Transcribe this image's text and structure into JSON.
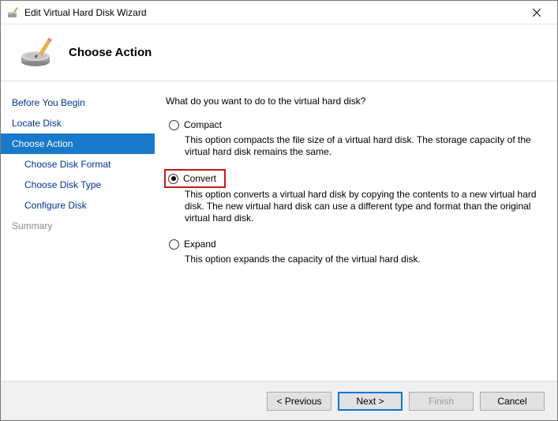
{
  "window": {
    "title": "Edit Virtual Hard Disk Wizard"
  },
  "header": {
    "title": "Choose Action"
  },
  "sidebar": {
    "items": [
      {
        "label": "Before You Begin",
        "state": "normal"
      },
      {
        "label": "Locate Disk",
        "state": "normal"
      },
      {
        "label": "Choose Action",
        "state": "selected"
      },
      {
        "label": "Choose Disk Format",
        "state": "sub"
      },
      {
        "label": "Choose Disk Type",
        "state": "sub"
      },
      {
        "label": "Configure Disk",
        "state": "sub"
      },
      {
        "label": "Summary",
        "state": "disabled"
      }
    ]
  },
  "content": {
    "question": "What do you want to do to the virtual hard disk?",
    "options": [
      {
        "label": "Compact",
        "selected": false,
        "highlighted": false,
        "description": "This option compacts the file size of a virtual hard disk. The storage capacity of the virtual hard disk remains the same."
      },
      {
        "label": "Convert",
        "selected": true,
        "highlighted": true,
        "description": "This option converts a virtual hard disk by copying the contents to a new virtual hard disk. The new virtual hard disk can use a different type and format than the original virtual hard disk."
      },
      {
        "label": "Expand",
        "selected": false,
        "highlighted": false,
        "description": "This option expands the capacity of the virtual hard disk."
      }
    ]
  },
  "footer": {
    "previous": "< Previous",
    "next": "Next >",
    "finish": "Finish",
    "cancel": "Cancel"
  }
}
